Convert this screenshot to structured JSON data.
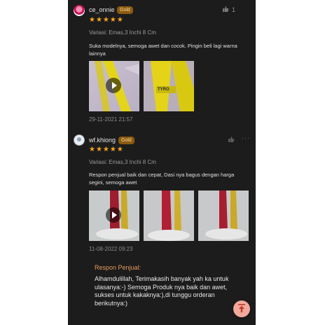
{
  "reviews": [
    {
      "username": "ce_onnie",
      "badge": "Gold",
      "stars": "★★★★★",
      "variant": "Variasi: Emas,3 Inchi 8 Cm",
      "text": "Suka modelnya, semoga awet dan cocok. Pingin beli lagi warna lainnya",
      "date": "29-11-2021 21:57",
      "likes": "1",
      "like_icon": "thumbs-up-icon",
      "media_thumb_text": "TYRO"
    },
    {
      "username": "wf.khiong",
      "badge": "Gold",
      "stars": "★★★★★",
      "variant": "Variasi: Emas,3 Inchi 8 Cm",
      "text": "Respon penjual baik dan cepat, Dasi nya bagus dengan harga segini, semoga awet",
      "date": "11-08-2022 09:23",
      "like_icon": "thumbs-up-icon"
    }
  ],
  "seller_response": {
    "label": "Respon Penjual:",
    "text": "Alhamdulillah, Terimakasih banyak yah ka untuk ulasanya:-) Semoga Produk nya baik dan awet, sukses untuk kakaknya:),di tunggu orderan berikutnya:)"
  },
  "colors": {
    "background": "#1c1c1c",
    "star": "#f5a623",
    "badge": "#8a5a10",
    "seller_label": "#e59a5a",
    "fab": "#f2a99a"
  },
  "icons": {
    "scroll_top": "arrow-up-to-top-icon",
    "play": "play-icon",
    "more": "more-dots-icon"
  }
}
